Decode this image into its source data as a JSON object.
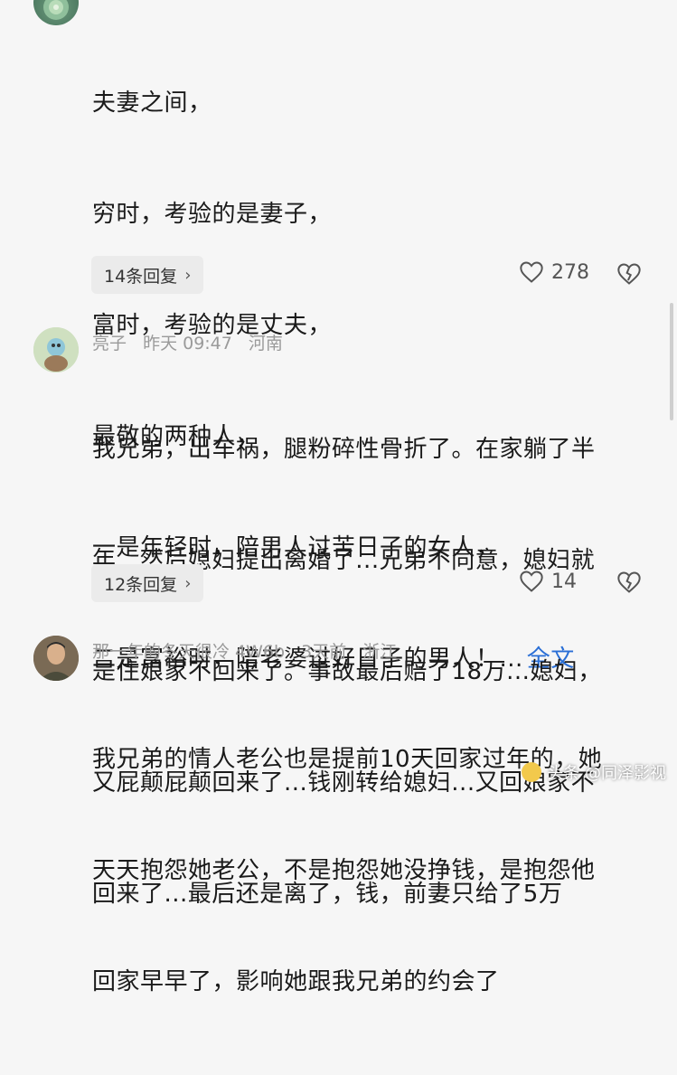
{
  "comments": [
    {
      "meta": {
        "name": "",
        "time": "",
        "region": ""
      },
      "lines": [
        "夫妻之间，",
        "穷时，考验的是妻子，",
        "富时，考验的是丈夫，",
        "最敬的两种人，",
        "一是年轻时，陪男人过苦日子的女人，",
        "二是富裕时，陪老婆过好日子的男人！..."
      ],
      "more_label": "全文",
      "reply_label": "14条回复",
      "likes": "278"
    },
    {
      "meta": {
        "name": "亮子",
        "time": "昨天 09:47",
        "region": "河南"
      },
      "lines": [
        "我兄弟，出车祸，腿粉碎性骨折了。在家躺了半",
        "年...然后媳妇提出离婚了...兄弟不同意，媳妇就",
        "是住娘家不回来了。事故最后赔了18万...媳妇，",
        "又屁颠屁颠回来了...钱刚转给媳妇...又回娘家不",
        "回来了...最后还是离了，钱，前妻只给了5万"
      ],
      "reply_label": "12条回复",
      "likes": "14"
    },
    {
      "meta": {
        "name": "那一年的冬天很冷 4W6b",
        "time": "3天前",
        "region": "浙江"
      },
      "lines": [
        "我兄弟的情人老公也是提前10天回家过年的，她",
        "天天抱怨她老公，不是抱怨她没挣钱，是抱怨他",
        "回家早早了，影响她跟我兄弟的约会了"
      ]
    }
  ],
  "watermark": {
    "text": "头条 @同泽影视"
  },
  "colors": {
    "link": "#2a6fd6",
    "meta": "#9a9a9a",
    "background": "#f6f6f6"
  }
}
